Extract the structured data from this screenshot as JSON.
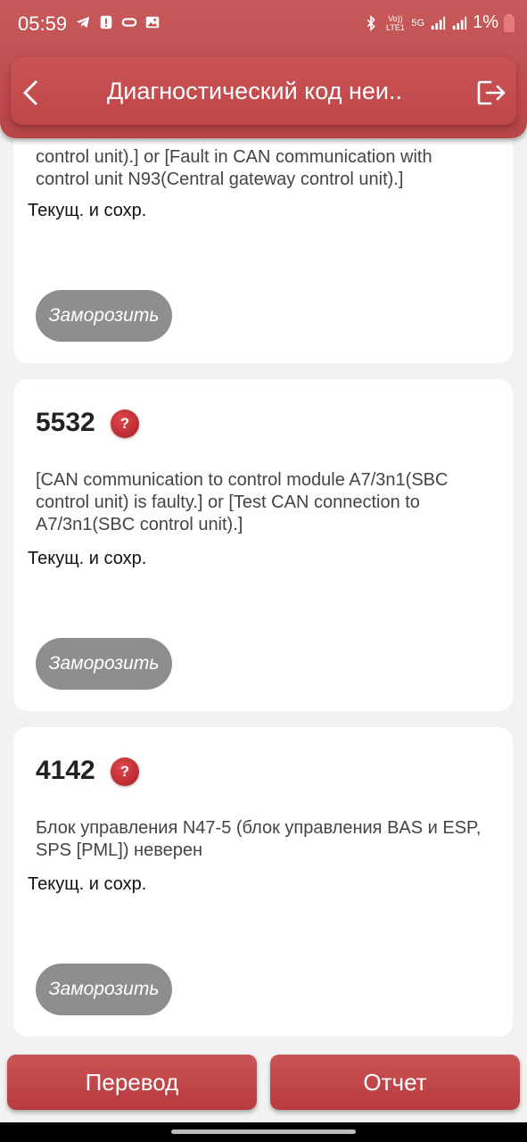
{
  "status_bar": {
    "time": "05:59",
    "battery": "1%",
    "network_labels": [
      "Vo)) LTE1",
      "5G"
    ]
  },
  "header": {
    "title": "Диагностический код неи..",
    "accent_color": "#c0474a"
  },
  "cards": [
    {
      "code": "",
      "description": "control unit).] or [Fault in CAN communication with control unit N93(Central gateway control unit).]",
      "status": "Текущ. и сохр.",
      "freeze_label": "Заморозить"
    },
    {
      "code": "5532",
      "description": "[CAN communication to control module A7/3n1(SBC control unit) is faulty.] or [Test CAN connection to A7/3n1(SBC control unit).]",
      "status": "Текущ. и сохр.",
      "freeze_label": "Заморозить"
    },
    {
      "code": "4142",
      "description": "Блок управления N47-5 (блок управления BAS и ESP, SPS [PML]) неверен",
      "status": "Текущ. и сохр.",
      "freeze_label": "Заморозить"
    }
  ],
  "help_icon_label": "?",
  "bottom_buttons": {
    "translate": "Перевод",
    "report": "Отчет"
  }
}
